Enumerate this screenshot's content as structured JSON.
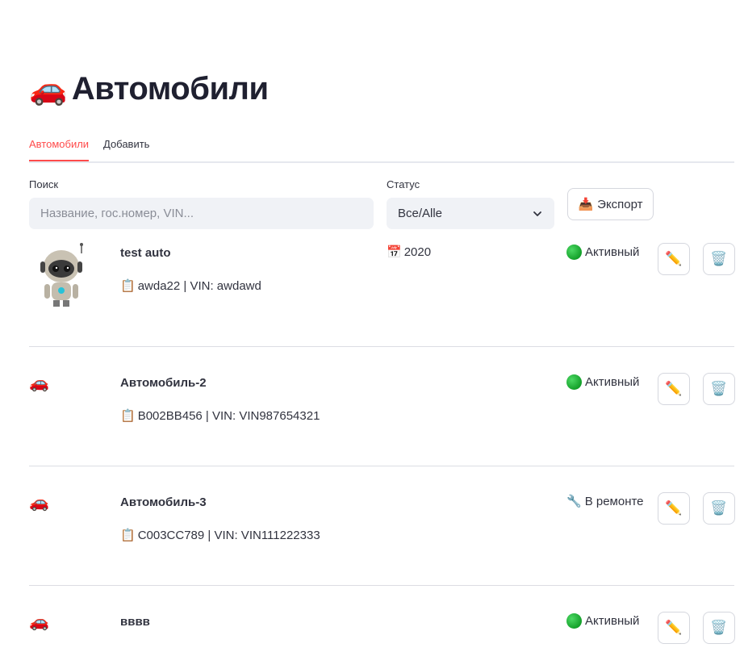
{
  "header": {
    "title": "Автомобили",
    "title_icon": "car-icon"
  },
  "tabs": [
    {
      "label": "Автомобили",
      "active": true
    },
    {
      "label": "Добавить",
      "active": false
    }
  ],
  "filters": {
    "search_label": "Поиск",
    "search_placeholder": "Название, гос.номер, VIN...",
    "search_value": "",
    "status_label": "Статус",
    "status_value": "Все/Alle",
    "export_label": "Экспорт",
    "export_icon": "inbox-tray-icon"
  },
  "cars": [
    {
      "name": "test auto",
      "plate": "awda22",
      "vin": "awdawd",
      "meta": "awda22 | VIN: awdawd",
      "year": "2020",
      "status": "Активный",
      "status_icon": "green-circle-icon",
      "photo": "robot-image"
    },
    {
      "name": "Автомобиль-2",
      "plate": "B002BB456",
      "vin": "VIN987654321",
      "meta": "B002BB456 | VIN: VIN987654321",
      "year": "",
      "status": "Активный",
      "status_icon": "green-circle-icon",
      "photo": "car-icon"
    },
    {
      "name": "Автомобиль-3",
      "plate": "C003CC789",
      "vin": "VIN111222333",
      "meta": "C003CC789 | VIN: VIN111222333",
      "year": "",
      "status": "В ремонте",
      "status_icon": "wrench-icon",
      "photo": "car-icon"
    },
    {
      "name": "вввв",
      "plate": "",
      "vin": "",
      "meta": "",
      "year": "",
      "status": "Активный",
      "status_icon": "green-circle-icon",
      "photo": "car-icon"
    }
  ],
  "icons": {
    "meta_icon": "clipboard-icon",
    "year_icon": "calendar-icon",
    "edit_icon": "pencil-icon",
    "delete_icon": "wastebasket-icon"
  },
  "colors": {
    "accent": "#ff4b4b",
    "input_bg": "#f0f2f6",
    "text": "#31333f"
  }
}
